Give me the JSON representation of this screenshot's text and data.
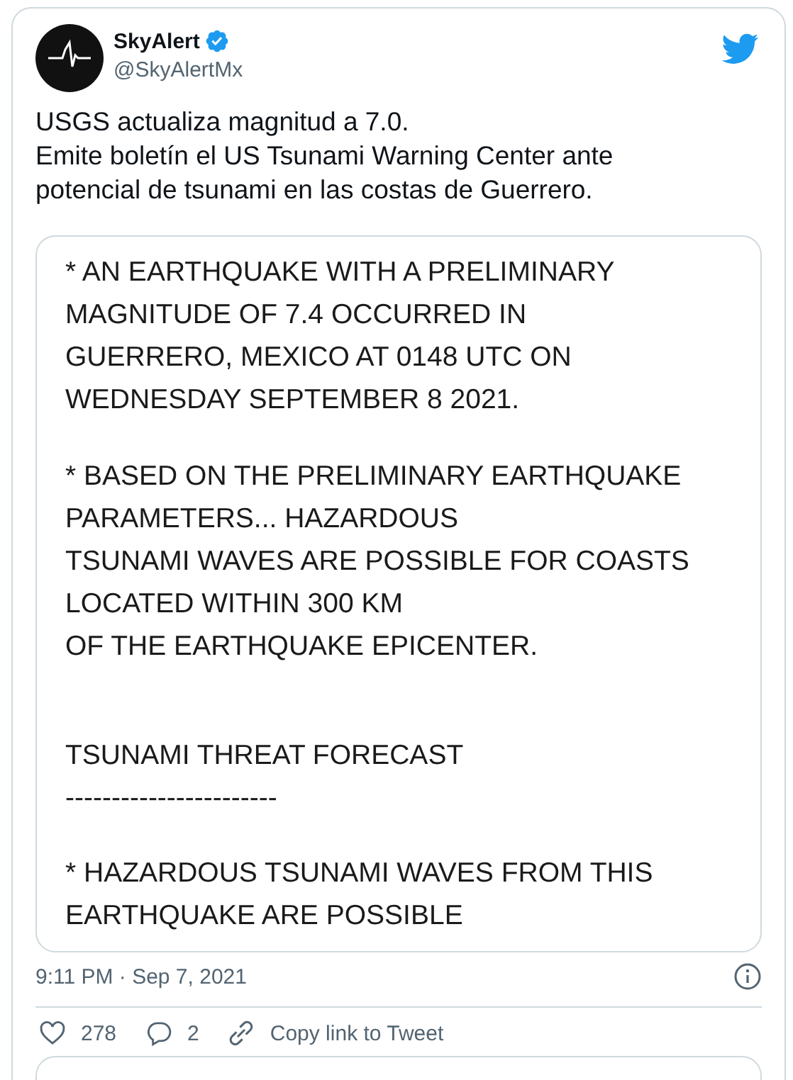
{
  "author": {
    "name": "SkyAlert",
    "verified": true,
    "handle": "@SkyAlertMx"
  },
  "tweet_text": [
    "USGS actualiza magnitud a 7.0.",
    "Emite boletín el US Tsunami Warning Center ante potencial de tsunami en las costas de Guerrero."
  ],
  "image_lines": [
    {
      "kind": "text",
      "text": "* AN EARTHQUAKE WITH A PRELIMINARY"
    },
    {
      "kind": "text",
      "text": "MAGNITUDE OF 7.4 OCCURRED IN"
    },
    {
      "kind": "text",
      "text": "GUERRERO, MEXICO AT 0148 UTC ON"
    },
    {
      "kind": "text",
      "text": "WEDNESDAY SEPTEMBER 8 2021."
    },
    {
      "kind": "blank"
    },
    {
      "kind": "text",
      "text": "* BASED ON THE PRELIMINARY EARTHQUAKE"
    },
    {
      "kind": "text",
      "text": "PARAMETERS... HAZARDOUS"
    },
    {
      "kind": "text",
      "text": "TSUNAMI WAVES ARE POSSIBLE FOR COASTS"
    },
    {
      "kind": "text",
      "text": "LOCATED WITHIN 300 KM"
    },
    {
      "kind": "text",
      "text": "OF THE EARTHQUAKE EPICENTER."
    },
    {
      "kind": "blank"
    },
    {
      "kind": "blank"
    },
    {
      "kind": "text",
      "text": "TSUNAMI THREAT FORECAST"
    },
    {
      "kind": "text",
      "text": "-----------------------"
    },
    {
      "kind": "blank"
    },
    {
      "kind": "text",
      "text": "* HAZARDOUS TSUNAMI WAVES FROM THIS"
    },
    {
      "kind": "text",
      "text": "EARTHQUAKE ARE POSSIBLE"
    }
  ],
  "timestamp": "9:11 PM · Sep 7, 2021",
  "actions": [
    {
      "kind": "like",
      "label": "278"
    },
    {
      "kind": "reply",
      "label": "2"
    },
    {
      "kind": "link",
      "label": "Copy link to Tweet"
    }
  ]
}
